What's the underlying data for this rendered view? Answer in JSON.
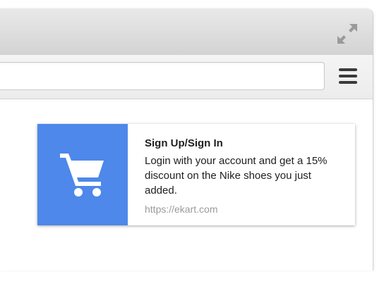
{
  "browser": {
    "icons": {
      "expand": "expand-arrows-icon",
      "menu": "hamburger-menu-icon"
    }
  },
  "notification": {
    "title": "Sign Up/Sign In",
    "message": "Login with your account and get a 15% discount on the Nike shoes you just added.",
    "url": "https://ekart.com",
    "icon": "shopping-cart-icon",
    "icon_background": "#4d88ea",
    "icon_color": "#ffffff"
  }
}
